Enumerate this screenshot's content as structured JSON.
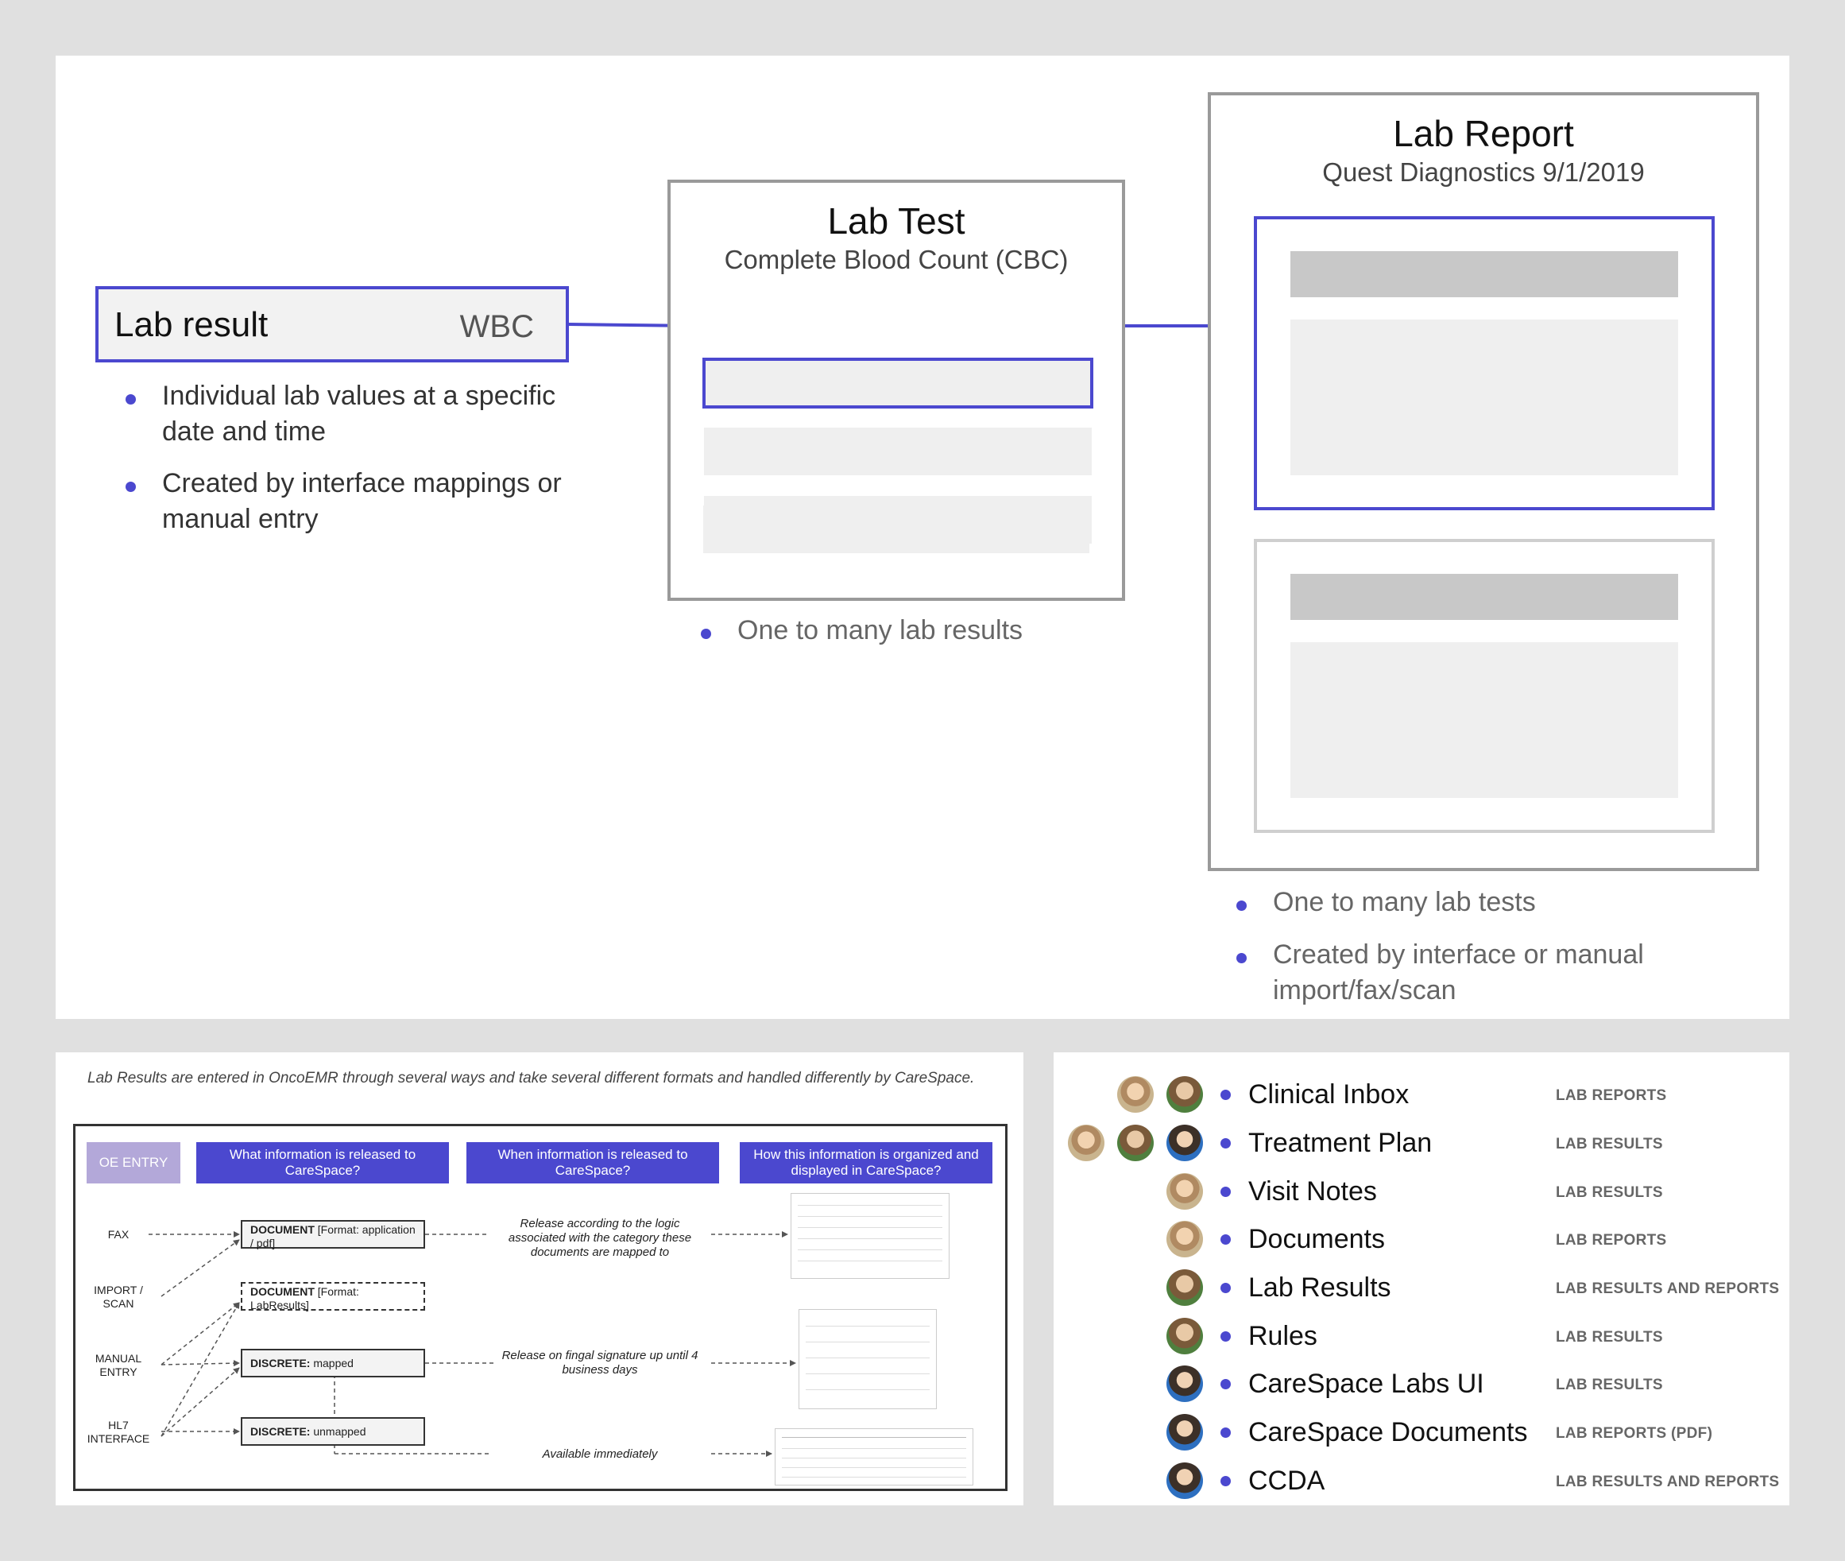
{
  "top_diagram": {
    "lab_result": {
      "title": "Lab result",
      "code": "WBC"
    },
    "lab_result_bullets": [
      "Individual lab values at a specific date and time",
      "Created by interface mappings or manual entry"
    ],
    "lab_test": {
      "title": "Lab Test",
      "subtitle": "Complete Blood Count (CBC)"
    },
    "lab_test_bullets": [
      "One to many lab results"
    ],
    "lab_report": {
      "title": "Lab Report",
      "subtitle": "Quest Diagnostics 9/1/2019"
    },
    "lab_report_bullets": [
      "One to many lab tests",
      "Created by interface or manual import/fax/scan"
    ],
    "colors": {
      "accent": "#4b48cf",
      "box_border": "#9a9a9a",
      "bar_dark": "#c8c8c8",
      "bar_light": "#efefef"
    }
  },
  "flow_panel": {
    "intro": "Lab Results are entered in OncoEMR through several ways and take several different formats and handled differently by CareSpace.",
    "entry_label": "OE ENTRY",
    "headers": [
      "What information is released to CareSpace?",
      "When information is released to CareSpace?",
      "How this information is organized and displayed in CareSpace?"
    ],
    "sources": [
      "FAX",
      "IMPORT / SCAN",
      "MANUAL ENTRY",
      "HL7 INTERFACE"
    ],
    "nodes": [
      {
        "bold": "DOCUMENT",
        "rest": " [Format: application / pdf]"
      },
      {
        "bold": "DOCUMENT",
        "rest": " [Format: LabResults]"
      },
      {
        "bold": "DISCRETE:",
        "rest": " mapped"
      },
      {
        "bold": "DISCRETE:",
        "rest": " unmapped"
      }
    ],
    "timing": [
      "Release according to the logic associated with the category these documents are mapped to",
      "Release on fingal signature up until 4 business days",
      "Available immediately"
    ]
  },
  "integration_panel": {
    "items": [
      {
        "name": "Clinical Inbox",
        "kind": "LAB REPORTS"
      },
      {
        "name": "Treatment Plan",
        "kind": "LAB RESULTS"
      },
      {
        "name": "Visit Notes",
        "kind": "LAB RESULTS"
      },
      {
        "name": "Documents",
        "kind": "LAB REPORTS"
      },
      {
        "name": "Lab Results",
        "kind": "LAB RESULTS AND REPORTS"
      },
      {
        "name": "Rules",
        "kind": "LAB RESULTS"
      },
      {
        "name": "CareSpace Labs UI",
        "kind": "LAB RESULTS"
      },
      {
        "name": "CareSpace Documents",
        "kind": "LAB REPORTS (PDF)"
      },
      {
        "name": "CCDA",
        "kind": "LAB RESULTS AND REPORTS"
      }
    ]
  }
}
